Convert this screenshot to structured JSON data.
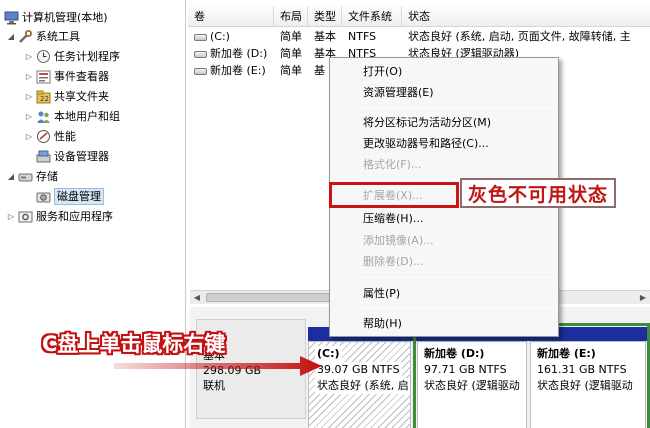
{
  "tree": {
    "items": [
      {
        "label": "计算机管理(本地)",
        "icon": "computer-management-icon"
      },
      {
        "label": "系统工具",
        "icon": "tools-icon"
      },
      {
        "label": "任务计划程序",
        "icon": "clock-icon"
      },
      {
        "label": "事件查看器",
        "icon": "event-viewer-icon"
      },
      {
        "label": "共享文件夹",
        "icon": "shared-folder-icon"
      },
      {
        "label": "本地用户和组",
        "icon": "users-icon"
      },
      {
        "label": "性能",
        "icon": "performance-icon"
      },
      {
        "label": "设备管理器",
        "icon": "device-manager-icon"
      },
      {
        "label": "存储",
        "icon": "storage-icon"
      },
      {
        "label": "磁盘管理",
        "icon": "disk-management-icon"
      },
      {
        "label": "服务和应用程序",
        "icon": "services-icon"
      }
    ]
  },
  "volumes": {
    "columns": [
      "卷",
      "布局",
      "类型",
      "文件系统",
      "状态"
    ],
    "rows": [
      {
        "name": "(C:)",
        "layout": "简单",
        "type": "基本",
        "fs": "NTFS",
        "status": "状态良好 (系统, 启动, 页面文件, 故障转储, 主"
      },
      {
        "name": "新加卷 (D:)",
        "layout": "简单",
        "type": "基本",
        "fs": "NTFS",
        "status": "状态良好 (逻辑驱动器)"
      },
      {
        "name": "新加卷 (E:)",
        "layout": "简单",
        "type": "基"
      }
    ]
  },
  "context_menu": {
    "items": [
      {
        "label": "打开(O)",
        "disabled": false
      },
      {
        "label": "资源管理器(E)",
        "disabled": false
      },
      {
        "label": "将分区标记为活动分区(M)",
        "disabled": false
      },
      {
        "label": "更改驱动器号和路径(C)...",
        "disabled": false
      },
      {
        "label": "格式化(F)...",
        "disabled": true
      },
      {
        "label": "扩展卷(X)...",
        "disabled": true
      },
      {
        "label": "压缩卷(H)...",
        "disabled": false
      },
      {
        "label": "添加镜像(A)...",
        "disabled": true
      },
      {
        "label": "删除卷(D)...",
        "disabled": true
      },
      {
        "label": "属性(P)",
        "disabled": false
      },
      {
        "label": "帮助(H)",
        "disabled": false
      }
    ]
  },
  "disk": {
    "type": "基本",
    "size": "298.09 GB",
    "state": "联机",
    "partitions": [
      {
        "name": "(C:)",
        "size": "39.07 GB NTFS",
        "status": "状态良好 (系统, 启"
      },
      {
        "name": "新加卷 (D:)",
        "size": "97.71 GB NTFS",
        "status": "状态良好 (逻辑驱动"
      },
      {
        "name": "新加卷 (E:)",
        "size": "161.31 GB NTFS",
        "status": "状态良好 (逻辑驱动"
      }
    ]
  },
  "annotations": {
    "gray_label": "灰色不可用状态",
    "right_click_label": "C盘上单击鼠标右键"
  },
  "colors": {
    "partition_bar": "#1a2e9e",
    "extended_frame": "#3d8b3d",
    "annotation_red": "#cc1414"
  }
}
